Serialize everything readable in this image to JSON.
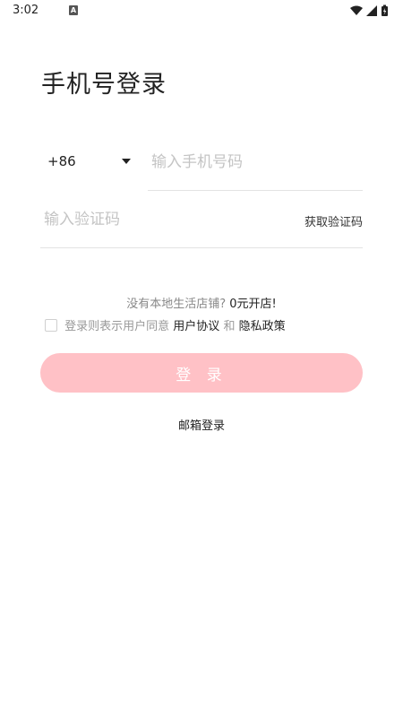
{
  "status_bar": {
    "time": "3:02",
    "app_icon_letter": "A",
    "icons": [
      "wifi-icon",
      "signal-icon",
      "battery-charging-icon"
    ]
  },
  "page_title": "手机号登录",
  "phone": {
    "country_code": "+86",
    "placeholder": "输入手机号码",
    "value": ""
  },
  "code": {
    "placeholder": "输入验证码",
    "value": "",
    "get_code_label": "获取验证码"
  },
  "promo": {
    "text": "没有本地生活店铺?",
    "link_label": "0元开店!"
  },
  "agreement": {
    "checked": false,
    "prefix": "登录则表示用户同意",
    "user_agreement_label": "用户协议",
    "and": "和",
    "privacy_policy_label": "隐私政策"
  },
  "login_button_label": "登 录",
  "email_login_label": "邮箱登录",
  "colors": {
    "login_button_bg": "#ffc1c6",
    "placeholder": "#c4c4c4",
    "divider": "#e3e3e3"
  }
}
